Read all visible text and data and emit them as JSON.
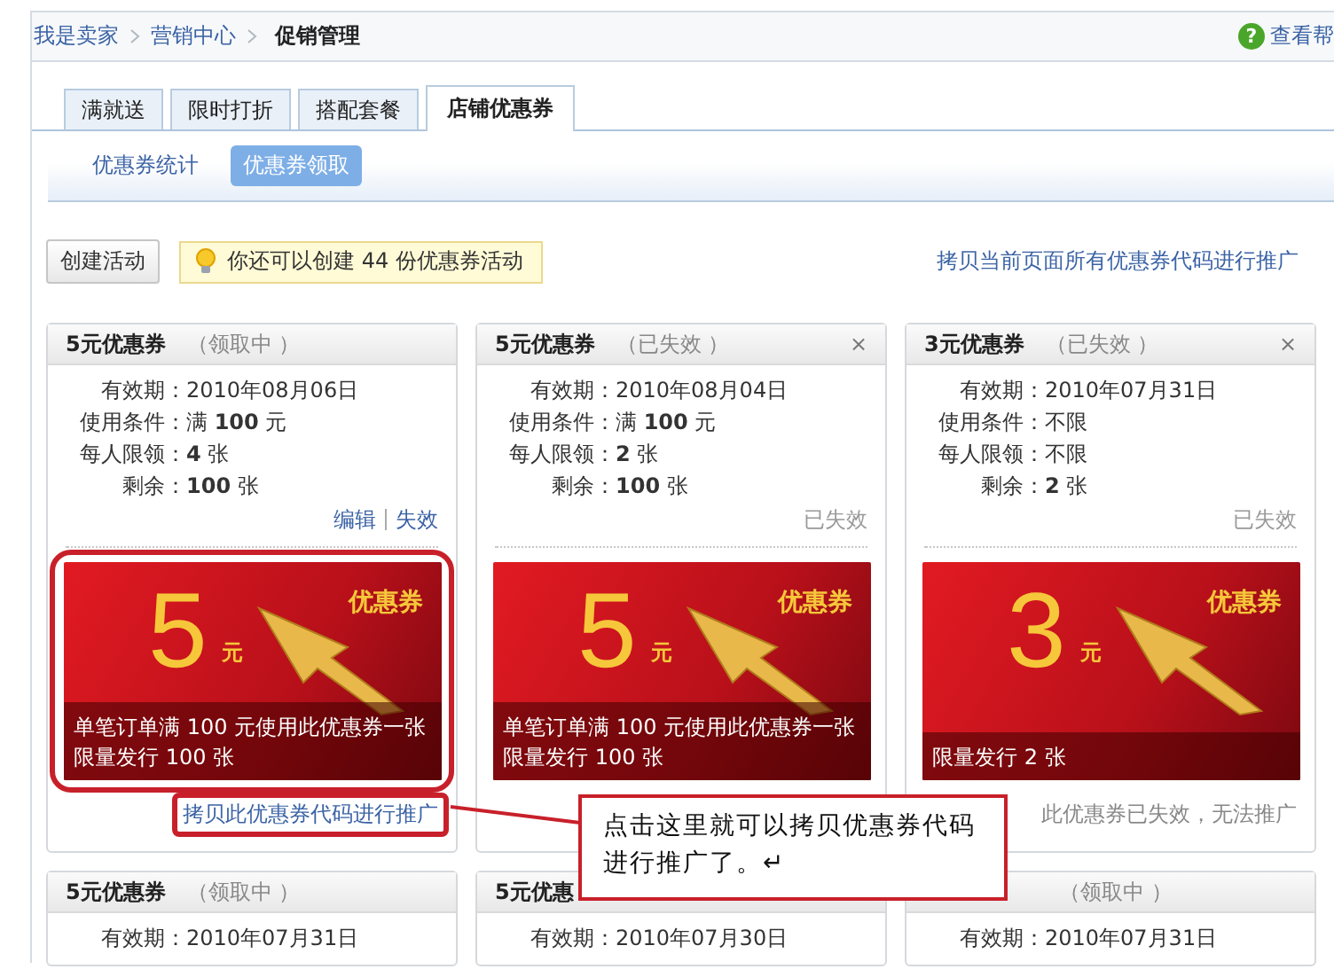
{
  "breadcrumb": [
    {
      "label": "我是卖家",
      "current": false
    },
    {
      "label": "营销中心",
      "current": false
    },
    {
      "label": "促销管理",
      "current": true
    }
  ],
  "help": {
    "icon": "?",
    "label": "查看帮"
  },
  "tabs": [
    {
      "label": "满就送",
      "selected": false
    },
    {
      "label": "限时打折",
      "selected": false
    },
    {
      "label": "搭配套餐",
      "selected": false
    },
    {
      "label": "店铺优惠券",
      "selected": true
    }
  ],
  "subtabs": [
    {
      "label": "优惠券统计",
      "selected": false
    },
    {
      "label": "优惠券领取",
      "selected": true
    }
  ],
  "create_button": "创建活动",
  "tip": "你还可以创建 44 份优惠券活动",
  "copy_all_link": "拷贝当前页面所有优惠券代码进行推广",
  "cards": [
    {
      "title": "5元优惠券",
      "status": "（领取中 ）",
      "fields": [
        {
          "label": "有效期：",
          "value": "2010年08月06日"
        },
        {
          "label": "使用条件：",
          "value": "满 **100** 元"
        },
        {
          "label": "每人限领：",
          "value": "**4** 张"
        },
        {
          "label": "剩余：",
          "value": "**100** 张"
        }
      ],
      "actions": [
        "编辑",
        "失效"
      ],
      "coupon": {
        "amount": "5",
        "unit": "元",
        "label": "优惠券",
        "lines": [
          "单笔订单满 100 元使用此优惠券一张",
          "限量发行 100 张"
        ],
        "highlighted": true
      },
      "footer": {
        "kind": "link",
        "text": "拷贝此优惠券代码进行推广",
        "highlighted": true
      }
    },
    {
      "title": "5元优惠券",
      "status": "（已失效 ）",
      "close": "×",
      "fields": [
        {
          "label": "有效期：",
          "value": "2010年08月04日"
        },
        {
          "label": "使用条件：",
          "value": "满 **100** 元"
        },
        {
          "label": "每人限领：",
          "value": "**2** 张"
        },
        {
          "label": "剩余：",
          "value": "**100** 张"
        }
      ],
      "note": "已失效",
      "coupon": {
        "amount": "5",
        "unit": "元",
        "label": "优惠券",
        "lines": [
          "单笔订单满 100 元使用此优惠券一张",
          "限量发行 100 张"
        ],
        "highlighted": false
      }
    },
    {
      "title": "3元优惠券",
      "status": "（已失效 ）",
      "close": "×",
      "fields": [
        {
          "label": "有效期：",
          "value": "2010年07月31日"
        },
        {
          "label": "使用条件：",
          "value": "不限"
        },
        {
          "label": "每人限领：",
          "value": "不限"
        },
        {
          "label": "剩余：",
          "value": "**2** 张"
        }
      ],
      "note": "已失效",
      "coupon": {
        "amount": "3",
        "unit": "元",
        "label": "优惠券",
        "lines": [
          "限量发行 2 张"
        ],
        "highlighted": false
      },
      "footer": {
        "kind": "note",
        "text": "此优惠券已失效，无法推广"
      }
    },
    {
      "title": "5元优惠券",
      "status": "（领取中 ）",
      "fields": [
        {
          "label": "有效期：",
          "value": "2010年07月31日"
        }
      ]
    },
    {
      "title": "5元优惠",
      "fields": [
        {
          "label": "有效期：",
          "value": "2010年07月30日"
        }
      ]
    },
    {
      "status": "（领取中 ）",
      "fields": [
        {
          "label": "有效期：",
          "value": "2010年07月31日"
        }
      ]
    }
  ],
  "callout": {
    "text": "点击这里就可以拷贝优惠券代码进行推广了。↵"
  }
}
